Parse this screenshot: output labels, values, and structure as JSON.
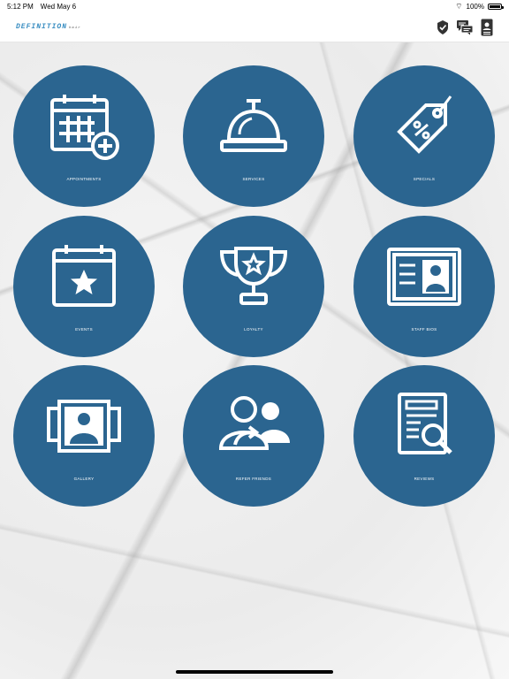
{
  "status_bar": {
    "time": "5:12 PM",
    "date": "Wed May 6",
    "battery": "100%"
  },
  "header": {
    "logo_text": "DEFINITION",
    "logo_suffix": "hair",
    "icons": [
      "checkin-badge-icon",
      "chat-bubbles-icon",
      "profile-card-icon"
    ]
  },
  "tiles": [
    {
      "label": "APPOINTMENTS",
      "icon": "calendar-plus-icon"
    },
    {
      "label": "SERVICES",
      "icon": "service-bell-icon"
    },
    {
      "label": "SPECIALS",
      "icon": "discount-tag-icon"
    },
    {
      "label": "EVENTS",
      "icon": "calendar-star-icon"
    },
    {
      "label": "LOYALTY",
      "icon": "trophy-icon"
    },
    {
      "label": "STAFF BIOS",
      "icon": "id-card-icon"
    },
    {
      "label": "GALLERY",
      "icon": "photo-gallery-icon"
    },
    {
      "label": "REFER FRIENDS",
      "icon": "refer-users-icon"
    },
    {
      "label": "REVIEWS",
      "icon": "document-search-icon"
    }
  ],
  "colors": {
    "tile": "#2b6590",
    "logo": "#3a8ec2"
  }
}
